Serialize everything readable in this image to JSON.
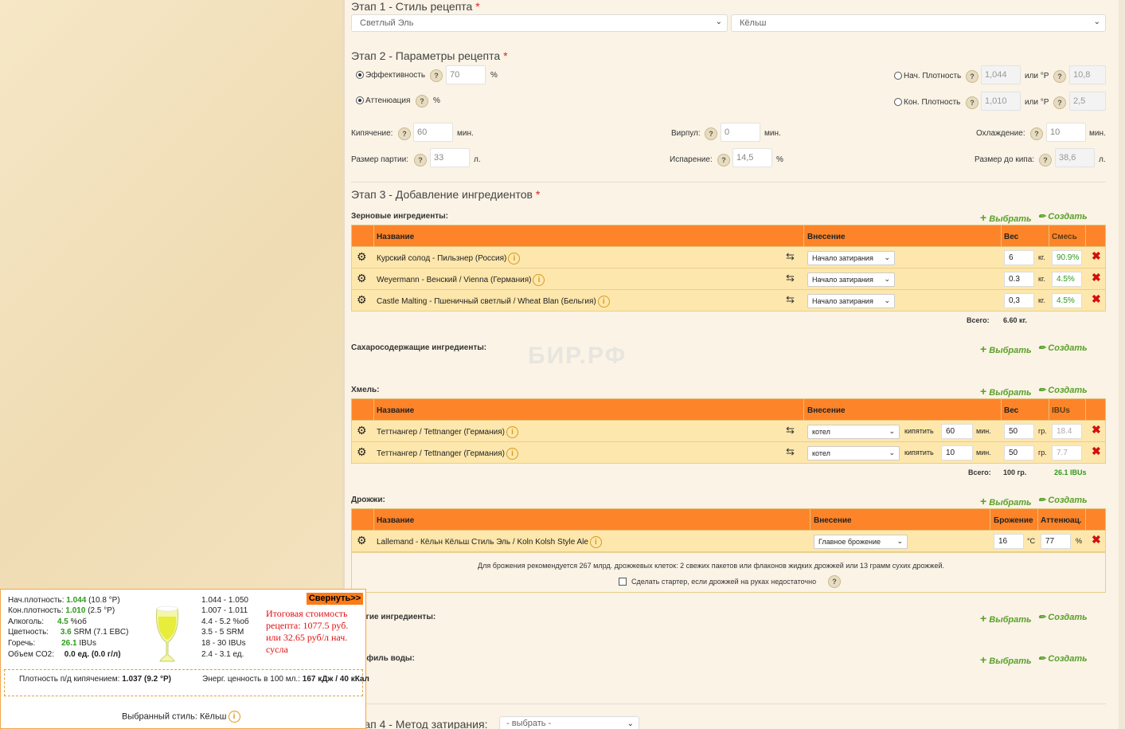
{
  "step1": {
    "title": "Этап 1 - Стиль рецепта",
    "required_mark": "*",
    "style_category": "Светлый Эль",
    "style_name": "Кёльш"
  },
  "step2": {
    "title": "Этап 2 - Параметры рецепта",
    "required_mark": "*",
    "efficiency_label": "Эффективность",
    "efficiency_value": "70",
    "efficiency_unit": "%",
    "attenuation_label": "Аттенюация",
    "attenuation_unit": "%",
    "og_label": "Нач. Плотность",
    "og_value": "1,044",
    "og_or_label": "или °P",
    "og_plato": "10,8",
    "fg_label": "Кон. Плотность",
    "fg_value": "1,010",
    "fg_or_label": "или °P",
    "fg_plato": "2,5",
    "boil_label": "Кипячение:",
    "boil_value": "60",
    "boil_unit": "мин.",
    "whirlpool_label": "Вирпул:",
    "whirlpool_value": "0",
    "whirlpool_unit": "мин.",
    "cooling_label": "Охлаждение:",
    "cooling_value": "10",
    "cooling_unit": "мин.",
    "batch_label": "Размер партии:",
    "batch_value": "33",
    "batch_unit": "л.",
    "evap_label": "Испарение:",
    "evap_value": "14,5",
    "evap_unit": "%",
    "preboil_label": "Размер до кипа:",
    "preboil_value": "38,6",
    "preboil_unit": "л.",
    "help": "?"
  },
  "step3": {
    "title": "Этап 3 - Добавление ингредиентов",
    "required_mark": "*",
    "select_label": "Выбрать",
    "create_label": "Создать",
    "grains": {
      "title": "Зерновые ингредиенты:",
      "headers": [
        "Название",
        "Внесение",
        "Вес",
        "Смесь"
      ],
      "rows": [
        {
          "name": "Курский солод - Пильзнер (Россия)",
          "addition": "Начало затирания",
          "weight": "6",
          "unit": "кг.",
          "mix": "90.9%"
        },
        {
          "name": "Weyermann - Венский / Vienna (Германия)",
          "addition": "Начало затирания",
          "weight": "0.3",
          "unit": "кг.",
          "mix": "4.5%"
        },
        {
          "name": "Castle Malting - Пшеничный светлый / Wheat Blan (Бельгия)",
          "addition": "Начало затирания",
          "weight": "0,3",
          "unit": "кг.",
          "mix": "4.5%"
        }
      ],
      "total_label": "Всего:",
      "total_value": "6.60 кг."
    },
    "sugars": {
      "title": "Сахаросодержащие ингредиенты:"
    },
    "hops": {
      "title": "Хмель:",
      "headers": [
        "Название",
        "Внесение",
        "Вес",
        "IBUs"
      ],
      "rows": [
        {
          "name": "Теттнангер / Tettnanger (Германия)",
          "addition": "котел",
          "action": "кипятить",
          "time": "60",
          "time_unit": "мин.",
          "weight": "50",
          "unit": "гр.",
          "ibu": "18.4"
        },
        {
          "name": "Теттнангер / Tettnanger (Германия)",
          "addition": "котел",
          "action": "кипятить",
          "time": "10",
          "time_unit": "мин.",
          "weight": "50",
          "unit": "гр.",
          "ibu": "7.7"
        }
      ],
      "total_label": "Всего:",
      "total_value": "100 гр.",
      "total_ibu": "26.1 IBUs"
    },
    "yeast": {
      "title": "Дрожжи:",
      "headers": [
        "Название",
        "Внесение",
        "Брожение",
        "Аттенюац."
      ],
      "row": {
        "name": "Lallemand - Кёльн Кёльш Стиль Эль / Koln Kolsh Style Ale",
        "addition": "Главное брожение",
        "temp": "16",
        "temp_unit": "°C",
        "atten": "77",
        "atten_unit": "%"
      },
      "note": "Для брожения рекомендуется 267 млрд. дрожжевых клеток: 2 свежих пакетов или флаконов жидких дрожжей или 13 грамм сухих дрожжей.",
      "starter_label": "Сделать стартер, если дрожжей на руках недостаточно"
    },
    "other": {
      "title": "Другие ингредиенты:"
    },
    "water": {
      "title": "Профиль воды:"
    }
  },
  "step4": {
    "title": "Этап 4 - Метод затирания:",
    "select_placeholder": "- выбрать -"
  },
  "watermark": {
    "text": "БИР.РФ"
  },
  "summary": {
    "og_label": "Нач.плотность:",
    "og_value": "1.044",
    "og_plato": "(10.8 °P)",
    "fg_label": "Кон.плотность:",
    "fg_value": "1.010",
    "fg_plato": "(2.5 °P)",
    "abv_label": "Алкоголь:",
    "abv_value": "4.5",
    "abv_unit": "%об",
    "color_label": "Цветность:",
    "color_value": "3.6",
    "color_unit": "SRM (7.1 EBC)",
    "ibu_label": "Горечь:",
    "ibu_value": "26.1",
    "ibu_unit": "IBUs",
    "co2_label": "Объем CO2:",
    "co2_value": "0.0 ед. (0.0 г/л)",
    "range_og": "1.044 - 1.050",
    "range_fg": "1.007 - 1.011",
    "range_abv": "4.4 - 5.2 %об",
    "range_color": "3.5 - 5 SRM",
    "range_ibu": "18 - 30 IBUs",
    "range_co2": "2.4 - 3.1 ед.",
    "collapse_label": "Свернуть>>",
    "cost_text": "Итоговая стоимость рецепта: 1077.5 руб. или 32.65 руб/л нач. сусла",
    "preboil_gravity_label": "Плотность п/д кипячением:",
    "preboil_gravity_value": "1.037 (9.2 °P)",
    "energy_label": "Энерг. ценность в 100 мл.:",
    "energy_value": "167 кДж / 40 кКал",
    "style_label": "Выбранный стиль:",
    "style_value": "Кёльш"
  },
  "colors": {
    "orange": "#fd8428",
    "row": "#fde7ac",
    "green": "#2c9b1a",
    "red": "#d01010"
  }
}
